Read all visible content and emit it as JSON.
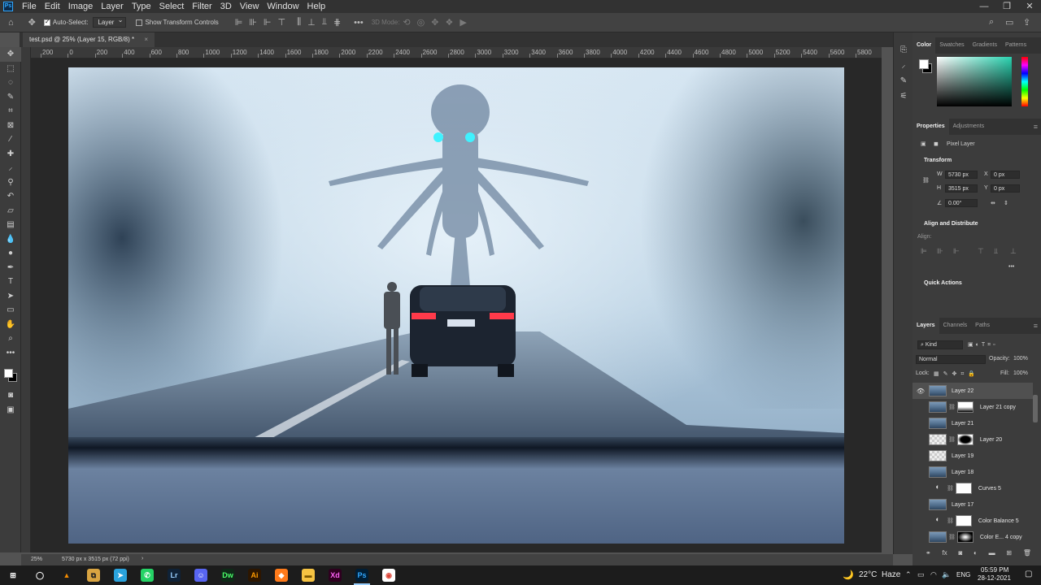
{
  "menubar": {
    "logo": "Ps",
    "items": [
      "File",
      "Edit",
      "Image",
      "Layer",
      "Type",
      "Select",
      "Filter",
      "3D",
      "View",
      "Window",
      "Help"
    ],
    "window_controls": [
      "—",
      "❐",
      "✕"
    ]
  },
  "options_bar": {
    "auto_select_label": "Auto-Select:",
    "auto_select_target": "Layer",
    "show_transform_label": "Show Transform Controls",
    "mode_3d_label": "3D Mode:"
  },
  "document_tab": {
    "title": "test.psd @ 25% (Layer 15, RGB/8) *",
    "close": "×"
  },
  "rulers": {
    "horizontal_ticks": [
      "200",
      "0",
      "200",
      "400",
      "600",
      "800",
      "1000",
      "1200",
      "1400",
      "1600",
      "1800",
      "2000",
      "2200",
      "2400",
      "2600",
      "2800",
      "3000",
      "3200",
      "3400",
      "3600",
      "3800",
      "4000",
      "4200",
      "4400",
      "4600",
      "4800",
      "5000",
      "5200",
      "5400",
      "5600",
      "5800"
    ]
  },
  "status_bar": {
    "zoom": "25%",
    "doc_info": "5730 px x 3515 px (72 ppi)",
    "arrow": "›"
  },
  "color_panel": {
    "tabs": [
      "Color",
      "Swatches",
      "Gradients",
      "Patterns"
    ],
    "active_tab": "Color",
    "foreground": "#ffffff",
    "background": "#000000",
    "hue_color": "#29d3b0"
  },
  "properties_panel": {
    "tabs": [
      "Properties",
      "Adjustments"
    ],
    "layer_type": "Pixel Layer",
    "transform_title": "Transform",
    "w_label": "W",
    "w_value": "5730 px",
    "h_label": "H",
    "h_value": "3515 px",
    "x_label": "X",
    "x_value": "0 px",
    "y_label": "Y",
    "y_value": "0 px",
    "angle_value": "0.00°",
    "align_title": "Align and Distribute",
    "align_label": "Align:",
    "more": "•••",
    "quick_actions_title": "Quick Actions"
  },
  "layers_panel": {
    "tabs": [
      "Layers",
      "Channels",
      "Paths"
    ],
    "kind_filter": "Kind",
    "blend_mode": "Normal",
    "opacity_label": "Opacity:",
    "opacity_value": "100%",
    "lock_label": "Lock:",
    "fill_label": "Fill:",
    "fill_value": "100%",
    "layers": [
      {
        "name": "Layer 22",
        "visible": true,
        "thumb": "photo",
        "mask": "none",
        "adjustment": false
      },
      {
        "name": "Layer 21 copy",
        "visible": false,
        "thumb": "photo",
        "mask": "blackbottom",
        "adjustment": false
      },
      {
        "name": "Layer 21",
        "visible": false,
        "thumb": "photo",
        "mask": "none",
        "adjustment": false
      },
      {
        "name": "Layer 20",
        "visible": false,
        "thumb": "trans",
        "mask": "black",
        "adjustment": false
      },
      {
        "name": "Layer 19",
        "visible": false,
        "thumb": "trans",
        "mask": "none",
        "adjustment": false
      },
      {
        "name": "Layer 18",
        "visible": false,
        "thumb": "photo",
        "mask": "none",
        "adjustment": false
      },
      {
        "name": "Curves 5",
        "visible": false,
        "thumb": "adj",
        "mask": "white",
        "adjustment": true
      },
      {
        "name": "Layer 17",
        "visible": false,
        "thumb": "photo",
        "mask": "none",
        "adjustment": false
      },
      {
        "name": "Color Balance 5",
        "visible": false,
        "thumb": "adj",
        "mask": "white",
        "adjustment": true
      },
      {
        "name": "Color E... 4 copy",
        "visible": false,
        "thumb": "photo",
        "mask": "dark",
        "adjustment": false
      }
    ],
    "footer_icons": [
      "link-icon",
      "fx-icon",
      "mask-icon",
      "adjustment-icon",
      "folder-icon",
      "new-layer-icon",
      "trash-icon"
    ]
  },
  "taskbar": {
    "weather_temp": "22°C",
    "weather_desc": "Haze",
    "language": "ENG",
    "time": "05:59 PM",
    "date": "28-12-2021",
    "apps": [
      "windows-start-icon",
      "cortana-icon",
      "vlc-icon",
      "app-icon",
      "telegram-icon",
      "whatsapp-icon",
      "lightroom-icon",
      "discord-icon",
      "dreamweaver-icon",
      "illustrator-icon",
      "app-orange-icon",
      "file-explorer-icon",
      "xd-icon",
      "photoshop-icon",
      "chrome-icon"
    ]
  }
}
